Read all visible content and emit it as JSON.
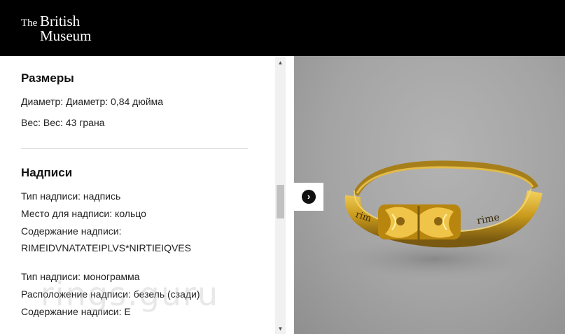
{
  "header": {
    "logo_the": "The",
    "logo_british": "British",
    "logo_museum": "Museum"
  },
  "dimensions": {
    "title": "Размеры",
    "diameter": "Диаметр: Диаметр: 0,84 дюйма",
    "weight": "Вес: Вес: 43 грана"
  },
  "inscriptions": {
    "title": "Надписи",
    "first": {
      "type": "Тип надписи: надпись",
      "position": "Место для надписи: кольцо",
      "content_label": "Содержание надписи:",
      "content_value": "RIMEIDVNATATEIPLVS*NIRTIEIQVES"
    },
    "second": {
      "type": "Тип надписи: монограмма",
      "position": "Расположение надписи: безель (сзади)",
      "content": "Содержание надписи: Е"
    }
  },
  "watermark": "rings.guru",
  "icons": {
    "scroll_up": "▲",
    "scroll_down": "▼",
    "next": "›"
  },
  "colors": {
    "header_bg": "#000000",
    "gold": "#c89a1a"
  }
}
